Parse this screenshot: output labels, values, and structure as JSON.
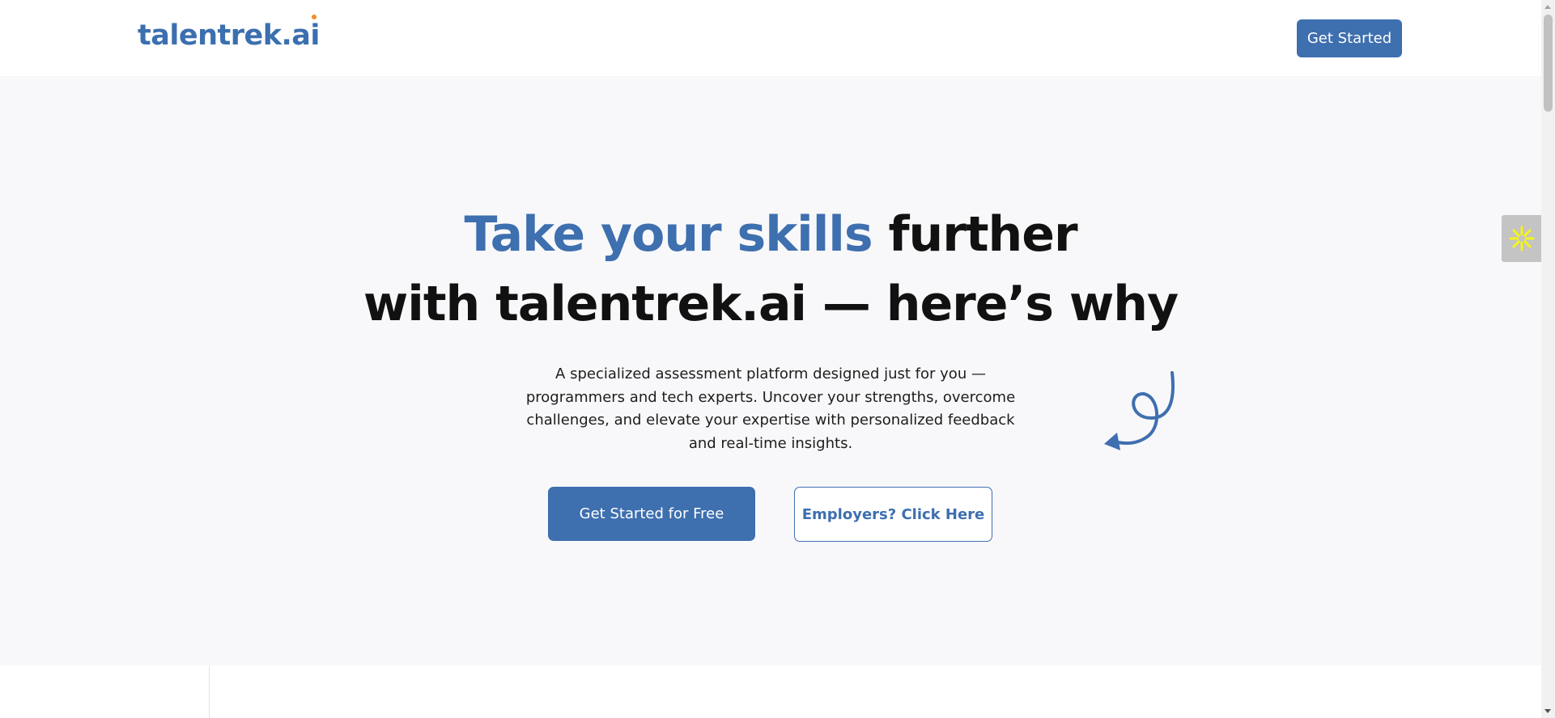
{
  "header": {
    "logo_text": "talentrek.ai",
    "cta_label": "Get Started"
  },
  "hero": {
    "headline_accent": "Take your skills",
    "headline_rest_line1": " further",
    "headline_line2": "with talentrek.ai — here’s why",
    "description": "A specialized assessment platform designed just for you — programmers and tech experts. Uncover your strengths, overcome challenges, and elevate your expertise with personalized feedback and real-time insights.",
    "primary_button": "Get Started for Free",
    "secondary_button": "Employers? Click Here"
  },
  "icons": {
    "side_widget": "asterisk-icon",
    "doodle": "curly-arrow-icon"
  },
  "colors": {
    "brand": "#3e6faf",
    "logo_accent": "#f08c2c",
    "hero_bg": "#f8f8fa",
    "widget_icon": "#f5f518"
  }
}
